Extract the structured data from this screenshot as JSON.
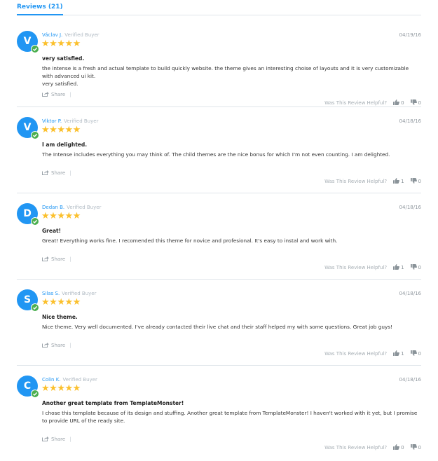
{
  "tab": {
    "label": "Reviews (21)"
  },
  "share_label": "Share",
  "helpful_label": "Was This Review Helpful?",
  "verified_label": "Verified Buyer",
  "colors": {
    "accent": "#2196f3",
    "star": "#fbc02d",
    "verified": "#4caf50"
  },
  "reviews": [
    {
      "initial": "V",
      "name": "Václav J.",
      "date": "04/19/16",
      "rating": 5,
      "title": "very satisfied.",
      "body": "the intense is a fresh and actual template to build quickly website. the theme gives an interesting choise of layouts and it is very customizable with advanced ui kit.\nvery satisfied.",
      "likes": "0",
      "dislikes": "0"
    },
    {
      "initial": "V",
      "name": "Viktor P.",
      "date": "04/18/16",
      "rating": 5,
      "title": "I am delighted.",
      "body": "The Intense includes everything you may think of. The child themes are the nice bonus for which I'm not even counting. I am delighted.",
      "likes": "1",
      "dislikes": "0"
    },
    {
      "initial": "D",
      "name": "Dedan B.",
      "date": "04/18/16",
      "rating": 5,
      "title": "Great!",
      "body": "Great! Everything works fine. I recomended this theme for novice and profesional. It's easy to instal and work with.",
      "likes": "1",
      "dislikes": "0"
    },
    {
      "initial": "S",
      "name": "Silas S.",
      "date": "04/18/16",
      "rating": 5,
      "title": "Nice theme.",
      "body": "Nice theme. Very well documented. I've already contacted their live chat and their staff helped my with some questions. Great job guys!",
      "likes": "1",
      "dislikes": "0"
    },
    {
      "initial": "C",
      "name": "Colin K.",
      "date": "04/18/16",
      "rating": 5,
      "title": "Another great template from TemplateMonster!",
      "body": "I chose this template because of its design and stuffing. Another great template from TemplateMonster! I haven't worked with it yet, but I promise to provide URL of the ready site.",
      "likes": "0",
      "dislikes": "0"
    }
  ]
}
